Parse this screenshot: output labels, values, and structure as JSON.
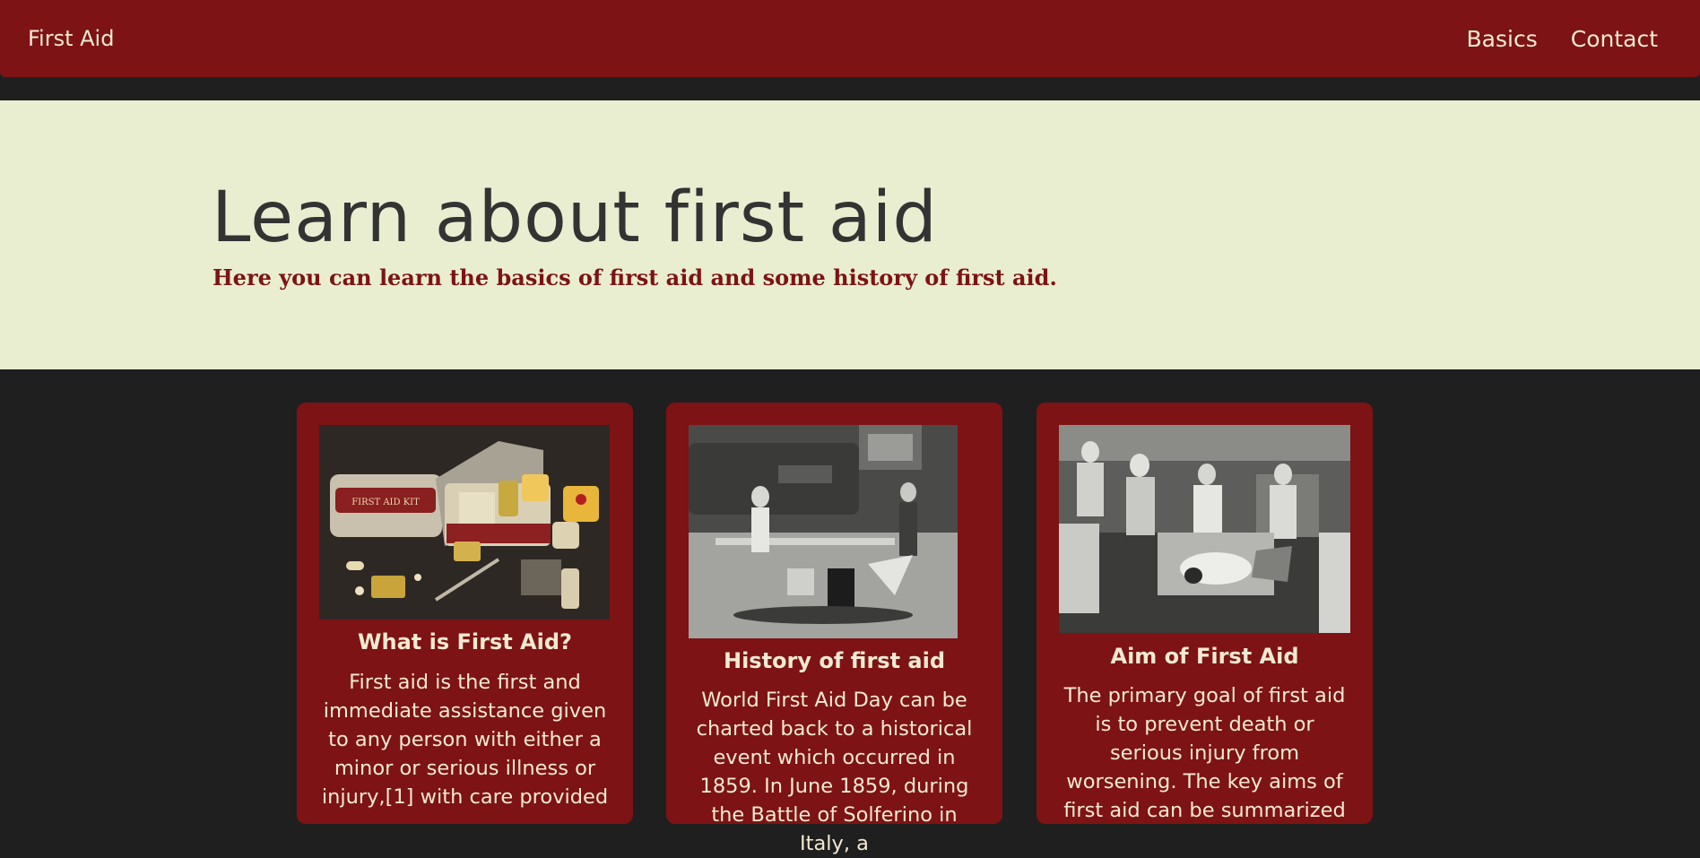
{
  "navbar": {
    "brand": "First Aid",
    "links": [
      {
        "label": "Basics"
      },
      {
        "label": "Contact"
      }
    ]
  },
  "hero": {
    "title": "Learn about first aid",
    "subtitle": "Here you can learn the basics of first aid and some history of first aid."
  },
  "cards": [
    {
      "title": "What is First Aid?",
      "text": "First aid is the first and immediate assistance given to any person with either a minor or serious illness or injury,[1] with care provided",
      "image": "first-aid-kit-photo"
    },
    {
      "title": "History of first aid",
      "text": "World First Aid Day can be charted back to a historical event which occurred in 1859. In June 1859, during the Battle of Solferino in Italy, a",
      "image": "historic-train-rescue-photo"
    },
    {
      "title": "Aim of First Aid",
      "text": "The primary goal of first aid is to prevent death or serious injury from worsening. The key aims of first aid can be summarized",
      "image": "first-aid-training-photo"
    }
  ],
  "colors": {
    "navbar": "#7d1314",
    "background": "#1f1f1f",
    "hero": "#e9eed1",
    "card": "#7d1314",
    "card_text": "#f3ead3"
  }
}
